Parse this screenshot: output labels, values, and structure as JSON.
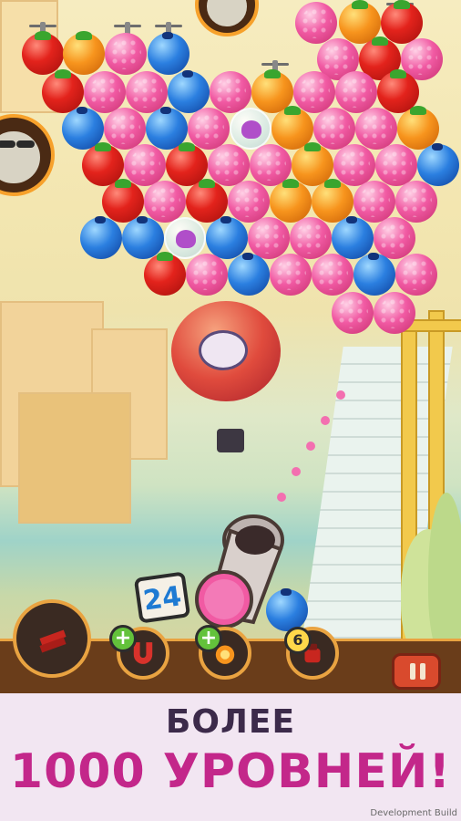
{
  "banner": {
    "line1": "БОЛЕЕ",
    "line2": "1000 УРОВНЕЙ!"
  },
  "hud": {
    "moves_left": "24",
    "booster_badge_1": "+",
    "booster_badge_2": "+",
    "booster_badge_3": "6"
  },
  "footer": {
    "dev_build": "Development Build"
  },
  "colors": {
    "banner_bg": "#f2e6f2",
    "title_dark": "#3c2a4a",
    "title_pink": "#c3278a"
  }
}
